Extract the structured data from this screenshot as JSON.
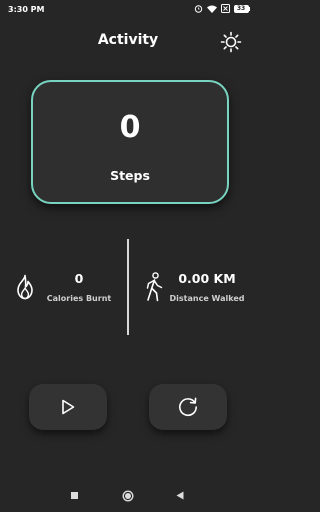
{
  "status_bar": {
    "time": "3:30 PM",
    "battery": "33"
  },
  "header": {
    "title": "Activity"
  },
  "steps": {
    "value": "0",
    "label": "Steps"
  },
  "calories": {
    "value": "0",
    "label": "Calories Burnt"
  },
  "distance": {
    "value": "0.00 KM",
    "label": "Distance Walked"
  },
  "colors": {
    "accent": "#79d3c1",
    "background": "#262626",
    "card": "#2f2f2f"
  },
  "icons": [
    "settings-sun-icon",
    "flame-icon",
    "walking-person-icon",
    "play-icon",
    "reset-icon"
  ]
}
